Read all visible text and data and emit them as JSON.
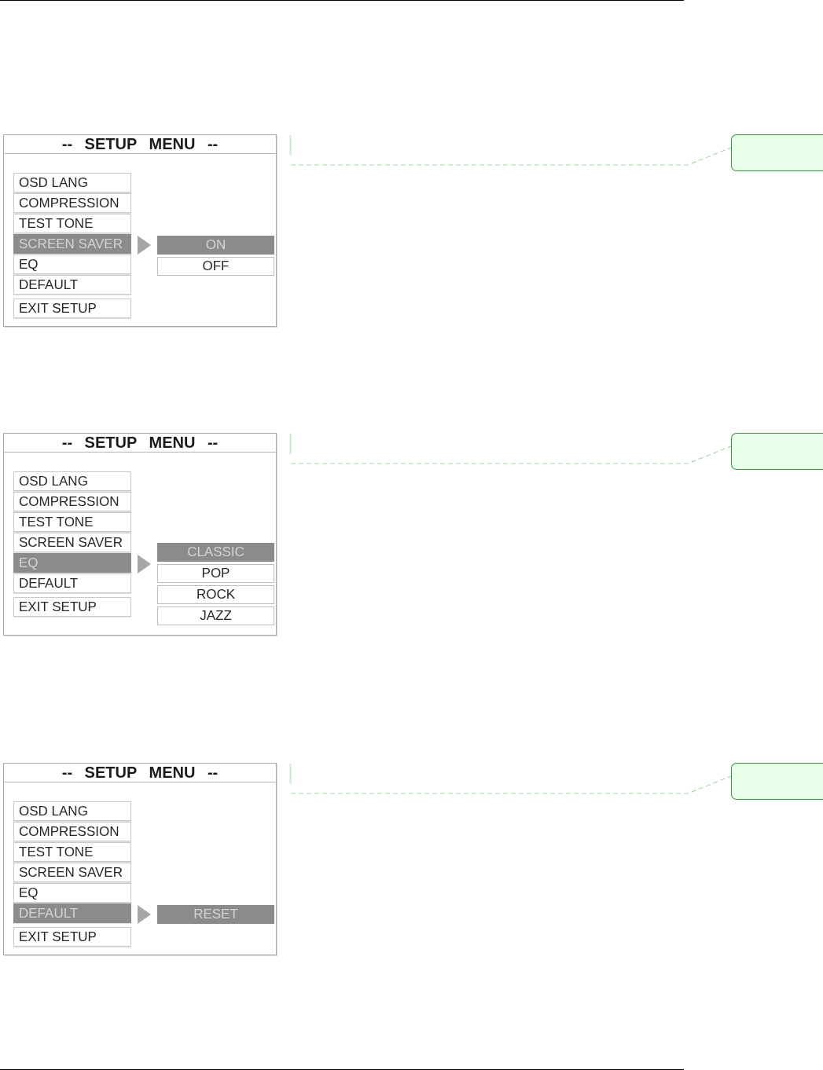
{
  "screens": [
    {
      "title": "-- SETUP MENU --",
      "items": [
        {
          "label": "OSD LANG",
          "selected": false,
          "kind": "option"
        },
        {
          "label": "COMPRESSION",
          "selected": false,
          "kind": "option"
        },
        {
          "label": "TEST TONE",
          "selected": false,
          "kind": "option"
        },
        {
          "label": "SCREEN SAVER",
          "selected": true,
          "kind": "option"
        },
        {
          "label": "EQ",
          "selected": false,
          "kind": "option"
        },
        {
          "label": "DEFAULT",
          "selected": false,
          "kind": "option"
        },
        {
          "label": "EXIT SETUP",
          "selected": false,
          "kind": "exit"
        }
      ],
      "submenu": [
        {
          "label": "ON",
          "selected": true
        },
        {
          "label": "OFF",
          "selected": false
        }
      ],
      "note": true
    },
    {
      "title": "-- SETUP MENU --",
      "items": [
        {
          "label": "OSD LANG",
          "selected": false,
          "kind": "option"
        },
        {
          "label": "COMPRESSION",
          "selected": false,
          "kind": "option"
        },
        {
          "label": "TEST TONE",
          "selected": false,
          "kind": "option"
        },
        {
          "label": "SCREEN SAVER",
          "selected": false,
          "kind": "option"
        },
        {
          "label": "EQ",
          "selected": true,
          "kind": "option"
        },
        {
          "label": "DEFAULT",
          "selected": false,
          "kind": "option"
        },
        {
          "label": "EXIT SETUP",
          "selected": false,
          "kind": "exit"
        }
      ],
      "submenu": [
        {
          "label": "CLASSIC",
          "selected": true
        },
        {
          "label": "POP",
          "selected": false
        },
        {
          "label": "ROCK",
          "selected": false
        },
        {
          "label": "JAZZ",
          "selected": false
        }
      ],
      "note": true
    },
    {
      "title": "-- SETUP MENU --",
      "items": [
        {
          "label": "OSD LANG",
          "selected": false,
          "kind": "option"
        },
        {
          "label": "COMPRESSION",
          "selected": false,
          "kind": "option"
        },
        {
          "label": "TEST TONE",
          "selected": false,
          "kind": "option"
        },
        {
          "label": "SCREEN SAVER",
          "selected": false,
          "kind": "option"
        },
        {
          "label": "EQ",
          "selected": false,
          "kind": "option"
        },
        {
          "label": "DEFAULT",
          "selected": true,
          "kind": "option"
        },
        {
          "label": "EXIT SETUP",
          "selected": false,
          "kind": "exit"
        }
      ],
      "submenu": [
        {
          "label": "RESET",
          "selected": true
        }
      ],
      "note": true
    }
  ]
}
